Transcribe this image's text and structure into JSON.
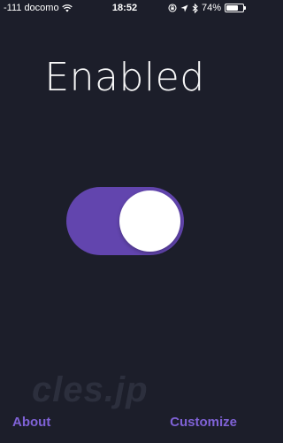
{
  "status_bar": {
    "carrier": "-111 docomo",
    "time": "18:52",
    "battery": "74%",
    "battery_level": 0.74
  },
  "title": "Enabled",
  "toggle": {
    "state": "on",
    "on_color": "#6245ae"
  },
  "watermark": "cles.jp",
  "footer": {
    "about_label": "About",
    "customize_label": "Customize"
  },
  "accent_color": "#7f62d6"
}
